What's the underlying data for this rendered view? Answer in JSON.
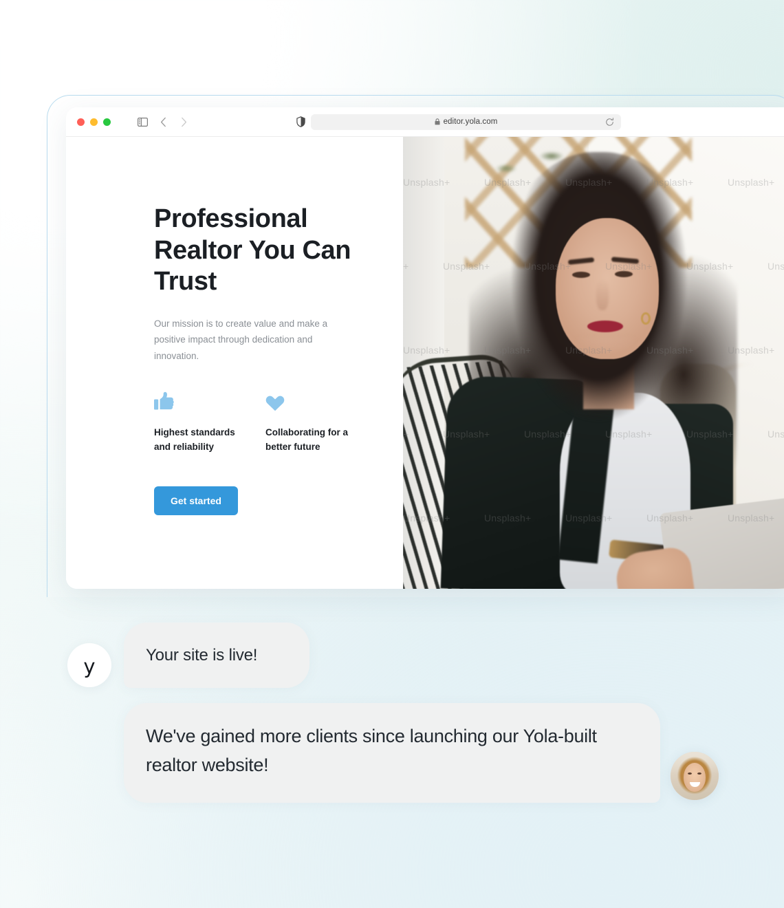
{
  "browser": {
    "url": "editor.yola.com",
    "controls": {
      "close": "close-window",
      "minimize": "minimize-window",
      "maximize": "maximize-window",
      "sidebar": "sidebar-toggle",
      "back": "‹",
      "forward": "›",
      "shield": "privacy-shield",
      "lock": "secure-lock",
      "reload": "reload-page"
    }
  },
  "site": {
    "headline": "Professional Realtor You Can Trust",
    "subhead": "Our mission is to create value and make a positive impact through dedication and innovation.",
    "features": [
      {
        "icon": "thumbs-up-icon",
        "label": "Highest standards and reliability"
      },
      {
        "icon": "heart-icon",
        "label": "Collaborating for a better future"
      }
    ],
    "cta_label": "Get started",
    "hero_image": {
      "alt": "Smiling professional woman with curly dark hair sitting with a laptop",
      "watermark": "Unsplash+"
    }
  },
  "chat": {
    "brand_glyph": "y",
    "messages": [
      {
        "from": "yola",
        "text": "Your site is live!"
      },
      {
        "from": "user",
        "text": "We've gained more clients since launching our Yola-built realtor website!"
      }
    ]
  },
  "colors": {
    "accent_blue": "#3498db",
    "icon_blue": "#8cc6ec",
    "text_dark": "#1b1f24",
    "text_muted": "#8a8f95",
    "bubble_bg": "#f0f1f1",
    "traffic_red": "#ff5f57",
    "traffic_yellow": "#febc2e",
    "traffic_green": "#28c840"
  }
}
